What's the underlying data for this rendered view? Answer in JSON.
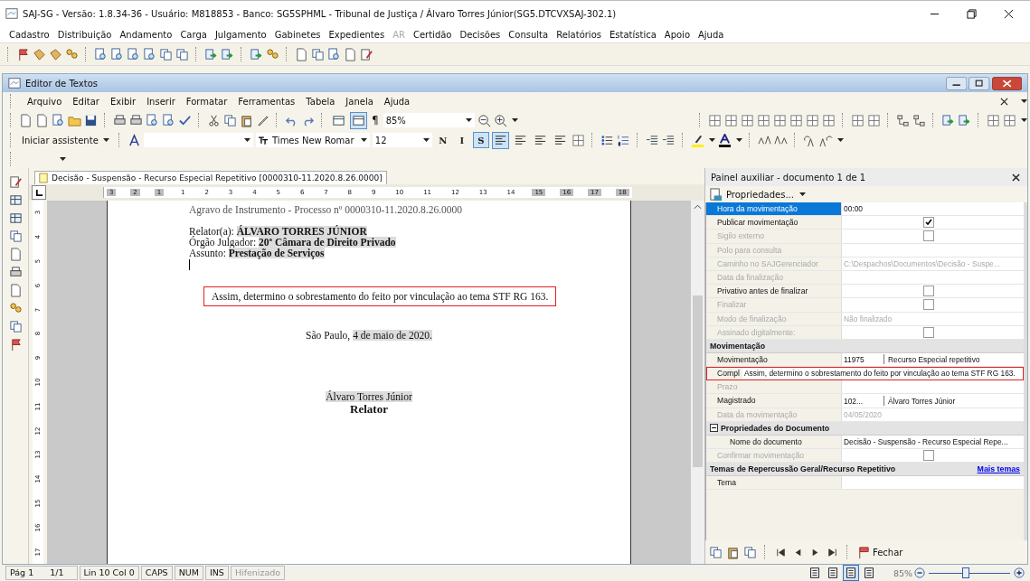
{
  "window": {
    "title": "SAJ-SG - Versão: 1.8.34-36 - Usuário: M818853 - Banco: SG5SPHML - Tribunal de Justiça / Álvaro Torres Júnior(SG5.DTCVXSAJ-302.1)"
  },
  "menu": [
    {
      "label": "Cadastro",
      "disabled": false
    },
    {
      "label": "Distribuição",
      "disabled": false
    },
    {
      "label": "Andamento",
      "disabled": false
    },
    {
      "label": "Carga",
      "disabled": false
    },
    {
      "label": "Julgamento",
      "disabled": false
    },
    {
      "label": "Gabinetes",
      "disabled": false
    },
    {
      "label": "Expedientes",
      "disabled": false
    },
    {
      "label": "AR",
      "disabled": true
    },
    {
      "label": "Certidão",
      "disabled": false
    },
    {
      "label": "Decisões",
      "disabled": false
    },
    {
      "label": "Consulta",
      "disabled": false
    },
    {
      "label": "Relatórios",
      "disabled": false
    },
    {
      "label": "Estatística",
      "disabled": false
    },
    {
      "label": "Apoio",
      "disabled": false
    },
    {
      "label": "Ajuda",
      "disabled": false
    }
  ],
  "editor": {
    "title": "Editor de Textos",
    "menu": [
      "Arquivo",
      "Editar",
      "Exibir",
      "Inserir",
      "Formatar",
      "Ferramentas",
      "Tabela",
      "Janela",
      "Ajuda"
    ],
    "layout_buttons": [
      {
        "selected": false
      },
      {
        "selected": true
      }
    ],
    "pilcrow": "¶",
    "zoom": "85%",
    "assistant": "Iniciar assistente",
    "font": "Times New Romar",
    "size": "12",
    "format_buttons": [
      {
        "label": "N",
        "selected": false
      },
      {
        "label": "I",
        "selected": false
      },
      {
        "label": "S",
        "selected": true
      }
    ],
    "alignment": [
      {
        "selected": true
      },
      {
        "selected": false
      },
      {
        "selected": false
      },
      {
        "selected": false
      }
    ],
    "tab": "Decisão - Suspensão - Recurso Especial Repetitivo [0000310-11.2020.8.26.0000]",
    "ruler": {
      "horizontal": [
        "3",
        "2",
        "1",
        "1",
        "2",
        "3",
        "4",
        "5",
        "6",
        "7",
        "8",
        "9",
        "10",
        "11",
        "12",
        "13",
        "14",
        "15",
        "16",
        "17",
        "18"
      ],
      "vertical": [
        "3",
        "4",
        "5",
        "6",
        "7",
        "8",
        "9",
        "10",
        "11",
        "12",
        "13",
        "14",
        "15",
        "16",
        "17"
      ]
    },
    "document": {
      "header": "Agravo de Instrumento - Processo nº 0000310-11.2020.8.26.0000",
      "fields": [
        {
          "label": "Relator(a): ",
          "value": "ÁLVARO TORRES JÚNIOR"
        },
        {
          "label": "Órgão Julgador: ",
          "value": "20ª Câmara de Direito Privado"
        },
        {
          "label": "Assunto: ",
          "value": "Prestação de Serviços"
        }
      ],
      "highlighted_paragraph": "Assim, determino o sobrestamento do feito por vinculação ao tema STF RG 163.",
      "place": "São Paulo, ",
      "date": "4 de maio de 2020.",
      "signer": "Álvaro Torres Júnior",
      "role": "Relator"
    }
  },
  "panel": {
    "title": "Painel auxiliar - documento 1 de 1",
    "properties_button": "Propriedades...",
    "rows": [
      {
        "kind": "text",
        "label": "Hora da movimentação",
        "values": [
          "00:00"
        ],
        "disabled": false,
        "selected": true
      },
      {
        "kind": "checkbox",
        "label": "Publicar movimentação",
        "checked": true,
        "disabled": false,
        "selected": false
      },
      {
        "kind": "checkbox",
        "label": "Sigilo externo",
        "checked": false,
        "disabled": true,
        "selected": false
      },
      {
        "kind": "text",
        "label": "Polo para consulta",
        "values": [],
        "disabled": true,
        "selected": false
      },
      {
        "kind": "text",
        "label": "Caminho no SAJGerenciador",
        "values": [
          "C:\\Despachos\\Documentos\\Decisão - Suspe..."
        ],
        "disabled": true,
        "selected": false
      },
      {
        "kind": "text",
        "label": "Data da finalização",
        "values": [],
        "disabled": true,
        "selected": false
      },
      {
        "kind": "checkbox",
        "label": "Privativo antes de finalizar",
        "checked": false,
        "disabled": false,
        "selected": false
      },
      {
        "kind": "checkbox",
        "label": "Finalizar",
        "checked": false,
        "disabled": true,
        "selected": false
      },
      {
        "kind": "text",
        "label": "Modo de finalização",
        "values": [
          "Não finalizado"
        ],
        "disabled": true,
        "selected": false
      },
      {
        "kind": "checkbox",
        "label": "Assinado digitalmente:",
        "checked": false,
        "disabled": true,
        "selected": false
      },
      {
        "kind": "section",
        "label": "Movimentação"
      },
      {
        "kind": "text",
        "label": "Movimentação",
        "values": [
          "11975",
          "Recurso Especial repetitivo"
        ],
        "disabled": false,
        "selected": false
      },
      {
        "kind": "text",
        "label": "Compl",
        "values": [],
        "disabled": false,
        "selected": false,
        "tooltip": "Assim, determino o sobrestamento do feito por vinculação ao tema STF RG 163."
      },
      {
        "kind": "text",
        "label": "Prazo",
        "values": [],
        "disabled": true,
        "selected": false
      },
      {
        "kind": "text",
        "label": "Magistrado",
        "values": [
          "102...",
          "Álvaro Torres Júnior"
        ],
        "disabled": false,
        "selected": false
      },
      {
        "kind": "text",
        "label": "Data da movimentação",
        "values": [
          "04/05/2020"
        ],
        "disabled": true,
        "selected": false
      },
      {
        "kind": "section",
        "label": "Propriedades do Documento",
        "expanded": true
      },
      {
        "kind": "text",
        "label": "Nome do documento",
        "values": [
          "Decisão - Suspensão - Recurso Especial Repe..."
        ],
        "disabled": false,
        "selected": false
      },
      {
        "kind": "checkbox",
        "label": "Confirmar movimentação",
        "checked": false,
        "disabled": true,
        "selected": false
      },
      {
        "kind": "section",
        "label": "Temas de Repercussão Geral/Recurso Repetitivo",
        "link": "Mais temas"
      },
      {
        "kind": "text",
        "label": "Tema",
        "values": [],
        "disabled": false,
        "selected": false
      }
    ],
    "close_button": "Fechar"
  },
  "status_bar": {
    "cells": [
      {
        "text": "Pág 1",
        "disabled": false
      },
      {
        "text": "1/1",
        "disabled": false
      },
      {
        "text": "Lin 10  Col 0",
        "disabled": false
      },
      {
        "text": "CAPS",
        "disabled": false
      },
      {
        "text": "NUM",
        "disabled": false
      },
      {
        "text": "INS",
        "disabled": false
      },
      {
        "text": "Hifenizado",
        "disabled": true
      }
    ],
    "views": [
      {
        "selected": false
      },
      {
        "selected": false
      },
      {
        "selected": true
      },
      {
        "selected": false
      }
    ],
    "zoom": "85%",
    "zoom_slider": {
      "level": 0.45
    }
  }
}
